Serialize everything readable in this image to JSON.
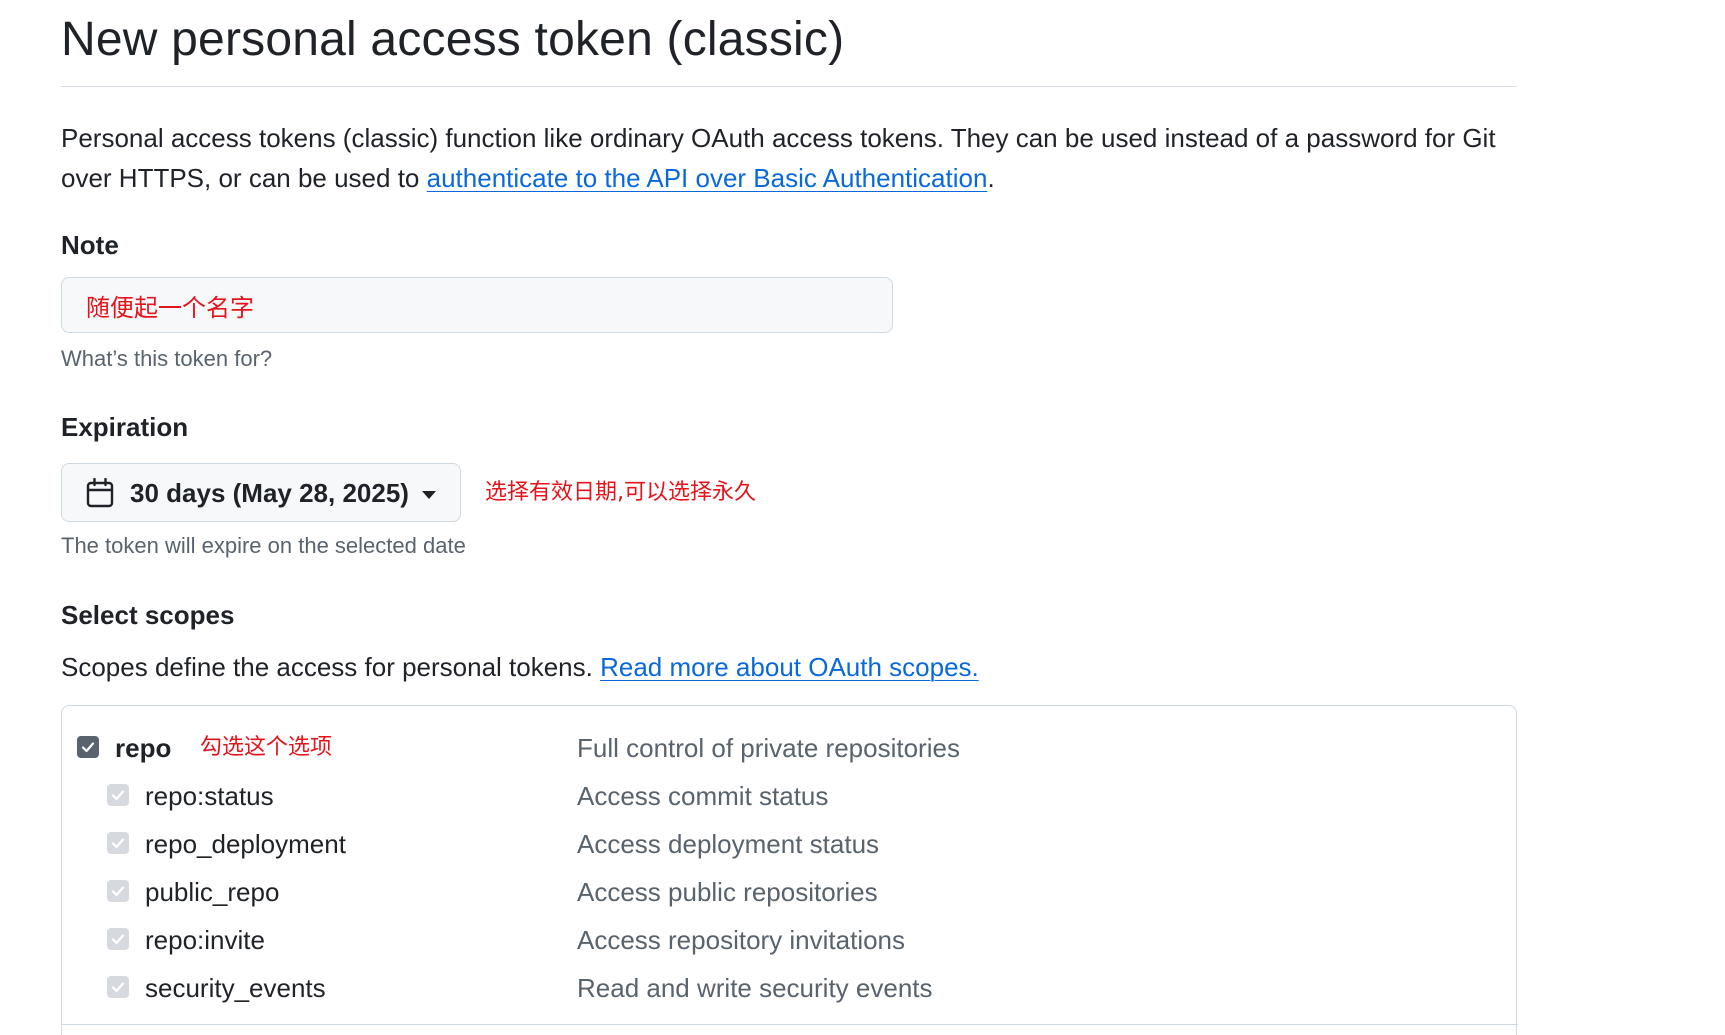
{
  "header": {
    "title": "New personal access token (classic)"
  },
  "intro": {
    "text_before": "Personal access tokens (classic) function like ordinary OAuth access tokens. They can be used instead of a password for Git over HTTPS, or can be used to ",
    "link_text": "authenticate to the API over Basic Authentication",
    "text_after": "."
  },
  "note": {
    "label": "Note",
    "placeholder": "",
    "value": "随便起一个名字",
    "hint": "What’s this token for?"
  },
  "expiration": {
    "label": "Expiration",
    "selected": "30 days (May 28, 2025)",
    "annotation": "选择有效日期,可以选择永久",
    "hint": "The token will expire on the selected date"
  },
  "scopes": {
    "label": "Select scopes",
    "description": "Scopes define the access for personal tokens. ",
    "link_text": "Read more about OAuth scopes.",
    "repo_annotation": "勾选这个选项",
    "items": [
      {
        "name": "repo",
        "description": "Full control of private repositories",
        "checked": true,
        "disabled": false
      },
      {
        "name": "repo:status",
        "description": "Access commit status",
        "checked": true,
        "disabled": true
      },
      {
        "name": "repo_deployment",
        "description": "Access deployment status",
        "checked": true,
        "disabled": true
      },
      {
        "name": "public_repo",
        "description": "Access public repositories",
        "checked": true,
        "disabled": true
      },
      {
        "name": "repo:invite",
        "description": "Access repository invitations",
        "checked": true,
        "disabled": true
      },
      {
        "name": "security_events",
        "description": "Read and write security events",
        "checked": true,
        "disabled": true
      }
    ]
  },
  "colors": {
    "link": "#0969da",
    "annotation": "#e5141b",
    "muted_text": "#59636e",
    "border": "#d1d9e0",
    "input_bg": "#f6f8fa"
  },
  "icons": {
    "expiration": "calendar-icon",
    "dropdown": "triangle-down-icon",
    "checkbox": "check-icon"
  }
}
